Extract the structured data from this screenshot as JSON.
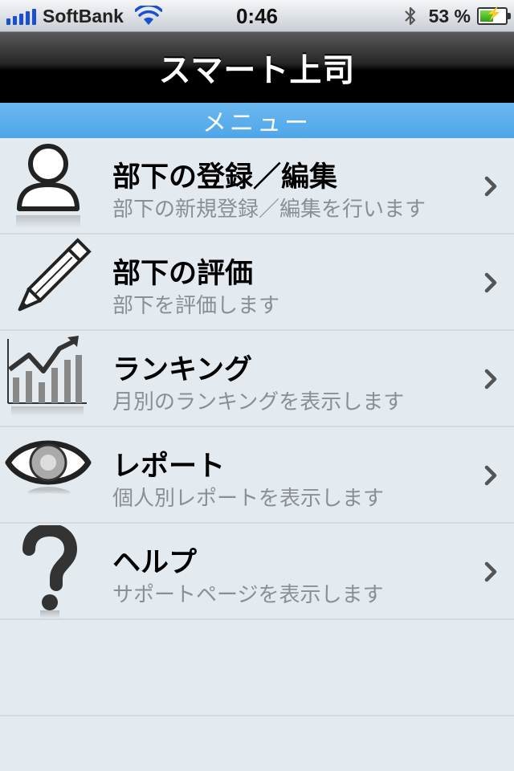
{
  "status_bar": {
    "carrier": "SoftBank",
    "time": "0:46",
    "battery_percent": "53 %",
    "battery_level": 0.53
  },
  "nav": {
    "title": "スマート上司"
  },
  "section": {
    "title": "メニュー"
  },
  "menu": [
    {
      "title": "部下の登録／編集",
      "subtitle": "部下の新規登録／編集を行います",
      "icon": "person-icon"
    },
    {
      "title": "部下の評価",
      "subtitle": "部下を評価します",
      "icon": "pencil-icon"
    },
    {
      "title": "ランキング",
      "subtitle": "月別のランキングを表示します",
      "icon": "chart-icon"
    },
    {
      "title": "レポート",
      "subtitle": "個人別レポートを表示します",
      "icon": "eye-icon"
    },
    {
      "title": "ヘルプ",
      "subtitle": "サポートページを表示します",
      "icon": "question-icon"
    }
  ],
  "colors": {
    "section_blue": "#5aaeec",
    "list_bg": "#e3eaf0",
    "subtitle_gray": "#8a8f95"
  }
}
